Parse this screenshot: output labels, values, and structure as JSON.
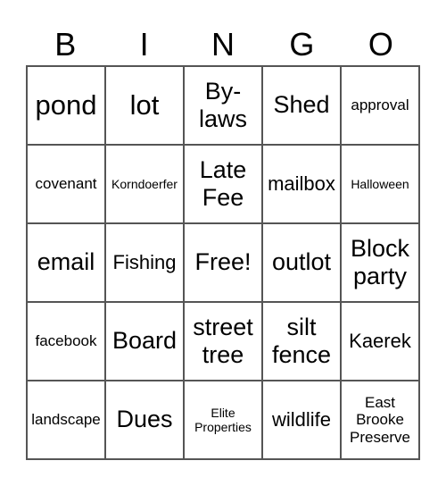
{
  "header": {
    "letters": [
      "B",
      "I",
      "N",
      "G",
      "O"
    ]
  },
  "cells": [
    {
      "text": "pond",
      "size": "s-xl"
    },
    {
      "text": "lot",
      "size": "s-xl"
    },
    {
      "text": "By-\nlaws",
      "size": "s-l"
    },
    {
      "text": "Shed",
      "size": "s-l"
    },
    {
      "text": "approval",
      "size": "s-s"
    },
    {
      "text": "covenant",
      "size": "s-s"
    },
    {
      "text": "Korndoerfer",
      "size": "s-xs"
    },
    {
      "text": "Late\nFee",
      "size": "s-l"
    },
    {
      "text": "mailbox",
      "size": "s-m"
    },
    {
      "text": "Halloween",
      "size": "s-xs"
    },
    {
      "text": "email",
      "size": "s-l"
    },
    {
      "text": "Fishing",
      "size": "s-m"
    },
    {
      "text": "Free!",
      "size": "s-l"
    },
    {
      "text": "outlot",
      "size": "s-l"
    },
    {
      "text": "Block\nparty",
      "size": "s-l"
    },
    {
      "text": "facebook",
      "size": "s-s"
    },
    {
      "text": "Board",
      "size": "s-l"
    },
    {
      "text": "street\ntree",
      "size": "s-l"
    },
    {
      "text": "silt\nfence",
      "size": "s-l"
    },
    {
      "text": "Kaerek",
      "size": "s-m"
    },
    {
      "text": "landscape",
      "size": "s-s"
    },
    {
      "text": "Dues",
      "size": "s-l"
    },
    {
      "text": "Elite\nProperties",
      "size": "s-xs"
    },
    {
      "text": "wildlife",
      "size": "s-m"
    },
    {
      "text": "East\nBrooke\nPreserve",
      "size": "s-s"
    }
  ]
}
